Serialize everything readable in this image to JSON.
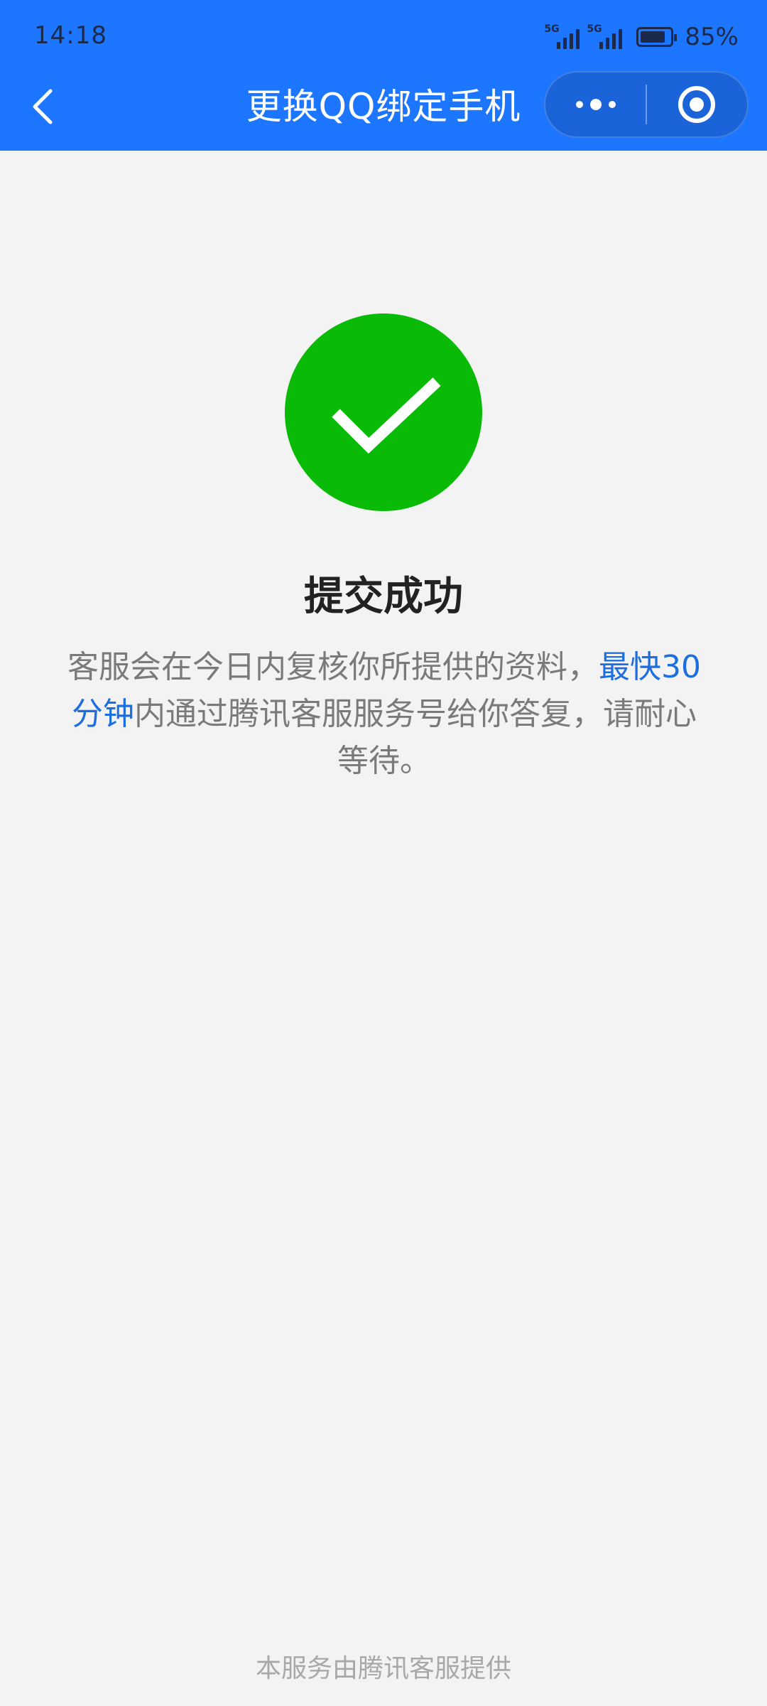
{
  "status_bar": {
    "time": "14:18",
    "network_1": "5G",
    "network_2": "5G",
    "battery_level": 0.85,
    "battery_text": "85%"
  },
  "nav": {
    "title": "更换QQ绑定手机",
    "back_icon": "chevron-left-icon",
    "more_icon": "more-dots-icon",
    "close_icon": "target-circle-icon"
  },
  "result": {
    "icon": "check-circle-icon",
    "title": "提交成功",
    "desc_part1": "客服会在今日内复核你所提供的资料，",
    "desc_highlight": "最快30分钟",
    "desc_part2": "内通过腾讯客服服务号给你答复，请耐心等待。"
  },
  "footer": {
    "text": "本服务由腾讯客服提供"
  },
  "colors": {
    "header_bg": "#1d76ff",
    "success_green": "#09bb07",
    "highlight_blue": "#1d6fe0",
    "page_bg": "#f3f3f3"
  }
}
